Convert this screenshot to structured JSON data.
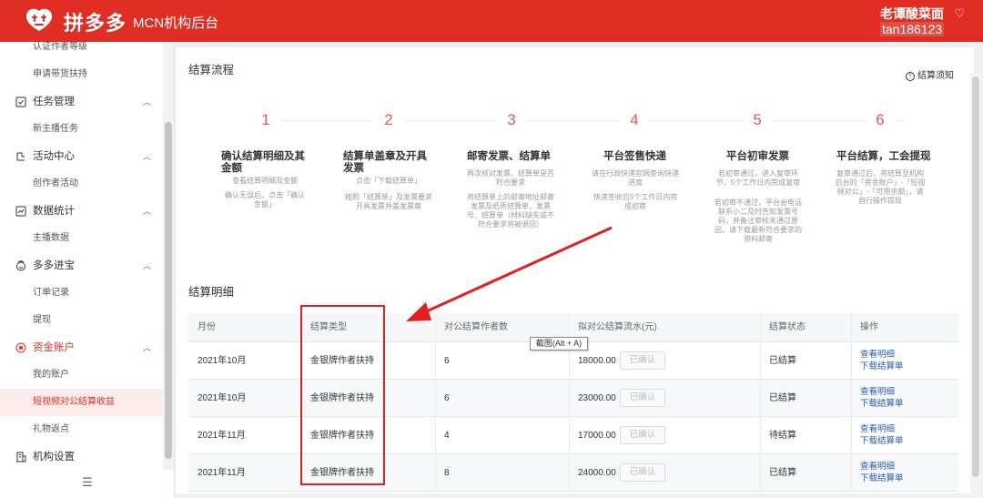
{
  "header": {
    "logo_text": "拼多多",
    "subtitle": "MCN机构后台",
    "user_name": "老谭酸菜面",
    "user_id": "tan186123",
    "accent": "#e02e24"
  },
  "sidebar": {
    "items": [
      {
        "label": "认证作者等级",
        "type": "sub"
      },
      {
        "label": "申请带货扶持",
        "type": "sub"
      },
      {
        "label": "任务管理",
        "type": "group",
        "icon": "checkbox-icon"
      },
      {
        "label": "新主播任务",
        "type": "sub"
      },
      {
        "label": "活动中心",
        "type": "group",
        "icon": "activity-icon"
      },
      {
        "label": "创作者活动",
        "type": "sub"
      },
      {
        "label": "数据统计",
        "type": "group",
        "icon": "chart-icon"
      },
      {
        "label": "主播数据",
        "type": "sub"
      },
      {
        "label": "多多进宝",
        "type": "group",
        "icon": "smile-icon"
      },
      {
        "label": "订单记录",
        "type": "sub"
      },
      {
        "label": "提现",
        "type": "sub"
      },
      {
        "label": "资金账户",
        "type": "group",
        "icon": "wallet-icon"
      },
      {
        "label": "我的账户",
        "type": "sub"
      },
      {
        "label": "短视频对公结算收益",
        "type": "sub",
        "active": true
      },
      {
        "label": "礼物返点",
        "type": "sub"
      },
      {
        "label": "机构设置",
        "type": "group",
        "icon": "building-icon"
      }
    ],
    "collapse_icon": "menu-fold-icon"
  },
  "flow": {
    "title": "结算流程",
    "guide": "结算须知",
    "steps": [
      {
        "num": "1",
        "title": "确认结算明细及其金额",
        "desc": "查看结算明细及金额",
        "desc2": "确认无误后，点击「确认金额」"
      },
      {
        "num": "2",
        "title": "结算单盖章及开具发票",
        "desc": "点击「下载结算单」",
        "desc2": "按照「结算单」及发票要求开具发票并盖发票章"
      },
      {
        "num": "3",
        "title": "邮寄发票、结算单",
        "desc": "再次核对发票、结算单是否符合要求",
        "desc2": "将结算单上的邮寄地址邮寄发票及纸质结算单，发票号、结算单（材料缺失或不符合要求将被退回）"
      },
      {
        "num": "4",
        "title": "平台签售快递",
        "desc": "请在行政快递官网查询快递进度",
        "desc2": "快递签收后5个工作日内完成初审"
      },
      {
        "num": "5",
        "title": "平台初审发票",
        "desc": "若初审通过，进入复审环节，5个工作日内完成复审",
        "desc2": "若初审不通过，平台会电话联系小二及时告知发票号码，并备注审核未通过原因，请下载最新符合要求的资料邮寄"
      },
      {
        "num": "6",
        "title": "平台结算，工会提现",
        "desc": "复审通过后，将结算至机构后台的「资金账户」-「短视频对公」-「可用余额」，请自行操作提现"
      }
    ]
  },
  "detail": {
    "title": "结算明细",
    "columns": [
      "月份",
      "结算类型",
      "对公结算作者数",
      "拟对公结算流水(元)",
      "结算状态",
      "操作"
    ],
    "rows": [
      {
        "month": "2021年10月",
        "type": "金银牌作者扶持",
        "count": "6",
        "amount": "18000.00",
        "confirm": "已确认",
        "status": "已结算",
        "link1": "查看明细",
        "link2": "下载结算单"
      },
      {
        "month": "2021年10月",
        "type": "金银牌作者扶持",
        "count": "6",
        "amount": "23000.00",
        "confirm": "已确认",
        "status": "已结算",
        "link1": "查看明细",
        "link2": "下载结算单"
      },
      {
        "month": "2021年11月",
        "type": "金银牌作者扶持",
        "count": "4",
        "amount": "17000.00",
        "confirm": "已确认",
        "status": "待结算",
        "link1": "查看明细",
        "link2": "下载结算单"
      },
      {
        "month": "2021年11月",
        "type": "金银牌作者扶持",
        "count": "8",
        "amount": "24000.00",
        "confirm": "已确认",
        "status": "已结算",
        "link1": "查看明细",
        "link2": "下载结算单"
      }
    ]
  },
  "tooltip": "截图(Alt + A)",
  "annotation_color": "#e02020"
}
